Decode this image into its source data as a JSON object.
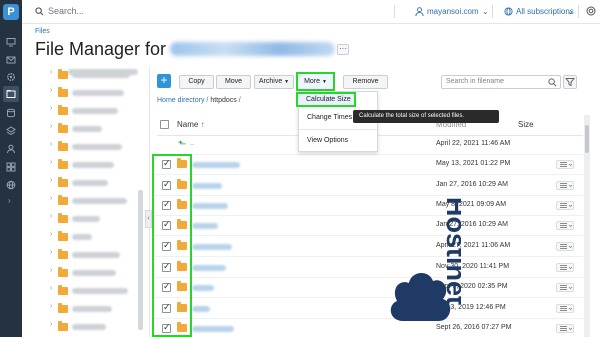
{
  "search": {
    "placeholder": "Search..."
  },
  "topbar": {
    "user": "mayansoi.com",
    "subscriptions": "All subscriptions"
  },
  "breadcrumb": "Files",
  "page": {
    "title": "File Manager for"
  },
  "toolbar": {
    "add": "+",
    "copy": "Copy",
    "move": "Move",
    "archive": "Archive",
    "more": "More",
    "remove": "Remove",
    "search_placeholder": "Search in filename"
  },
  "path": {
    "home": "Home directory",
    "current": "httpdocs"
  },
  "dropdown": {
    "calculate_size": "Calculate Size",
    "change_times": "Change Times",
    "view_options": "View Options"
  },
  "tooltip": "Calculate the total size of selected files.",
  "table": {
    "col_name": "Name",
    "col_modified": "Modified",
    "col_size": "Size",
    "parent": "..",
    "rows": [
      {
        "modified": "April 22, 2021 11:46 AM"
      },
      {
        "modified": "May 13, 2021 01:22 PM"
      },
      {
        "modified": "Jan 27, 2016 10:29 AM"
      },
      {
        "modified": "May 8, 2021 09:09 AM"
      },
      {
        "modified": "Jan 27, 2016 10:29 AM"
      },
      {
        "modified": "April 27, 2021 11:06 AM"
      },
      {
        "modified": "Nov 30, 2020 11:41 PM"
      },
      {
        "modified": "Sept 9, 2020 02:35 PM"
      },
      {
        "modified": "July 3, 2019 12:46 PM"
      },
      {
        "modified": "Sept 26, 2016 07:27 PM"
      }
    ]
  },
  "watermark": "Hostinet",
  "colors": {
    "rail": "#253240",
    "accent": "#2f95d8",
    "highlight": "#2bd42b",
    "folder": "#f1a93a"
  }
}
